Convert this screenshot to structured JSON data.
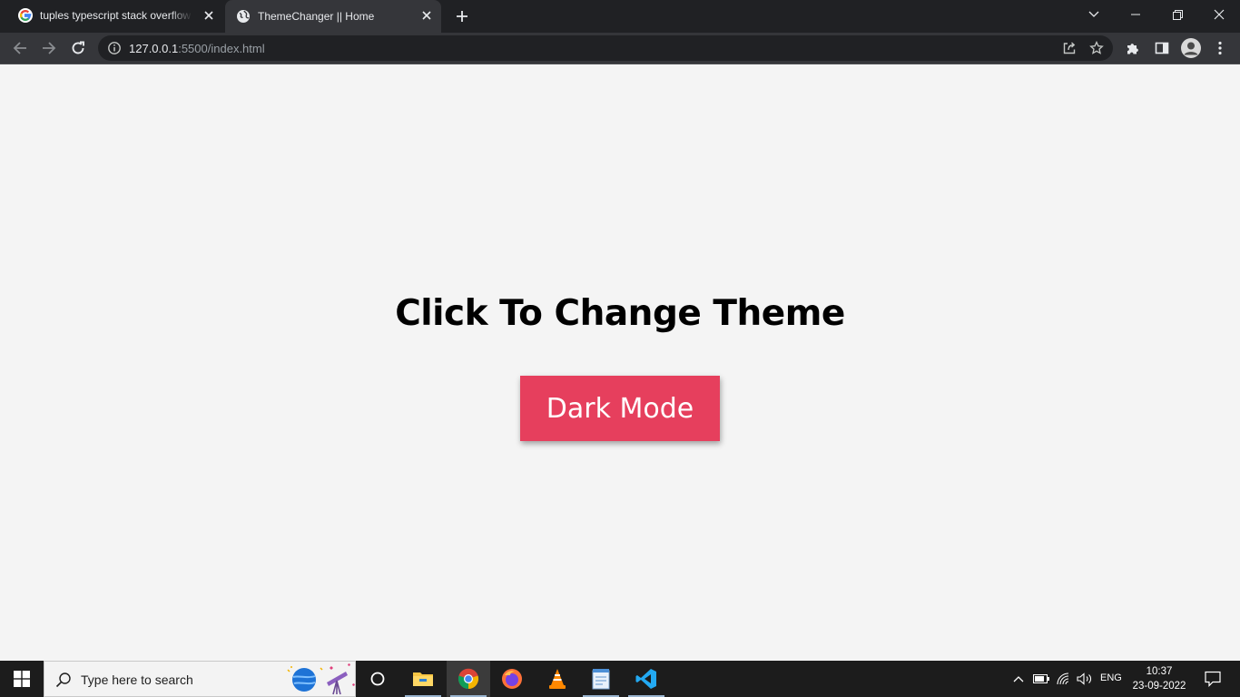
{
  "browser": {
    "tabs": [
      {
        "title": "tuples typescript stack overflow - Google Search",
        "icon": "google-g-icon",
        "active": false
      },
      {
        "title": "ThemeChanger || Home",
        "icon": "globe-icon",
        "active": true
      }
    ],
    "address_bar": {
      "host": "127.0.0.1",
      "rest": ":5500/index.html"
    },
    "colors": {
      "frame": "#202124",
      "toolbar": "#35363a",
      "omnibox": "#202124"
    }
  },
  "page": {
    "heading": "Click To Change Theme",
    "theme_button_label": "Dark Mode",
    "colors": {
      "background": "#f4f4f4",
      "button": "#e63f5d",
      "button_text": "#ffffff",
      "heading": "#000000"
    }
  },
  "taskbar": {
    "search_placeholder": "Type here to search",
    "apps": [
      "task-view-icon",
      "file-explorer-icon",
      "chrome-icon",
      "firefox-icon",
      "vlc-icon",
      "notepad-icon",
      "vscode-icon"
    ],
    "active_app": "chrome-icon",
    "language": "ENG",
    "time": "10:37",
    "date": "23-09-2022"
  }
}
